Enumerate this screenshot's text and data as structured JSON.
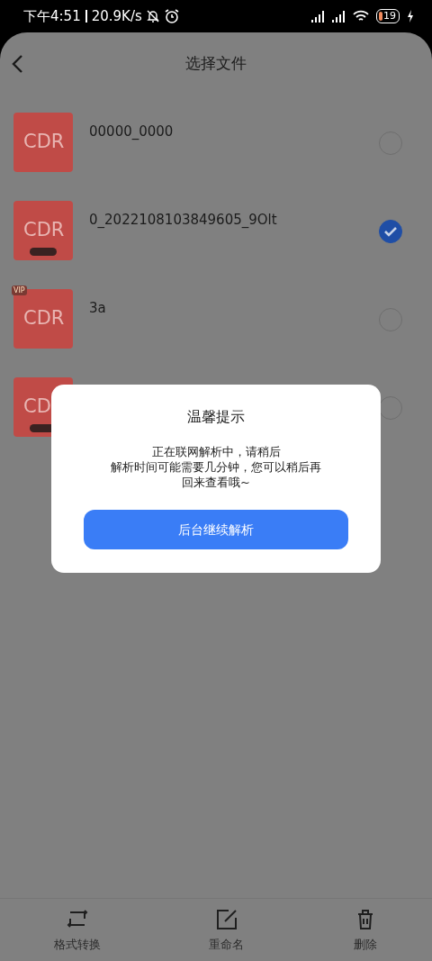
{
  "status_bar": {
    "time": "下午4:51",
    "speed": "20.9K/s",
    "battery": "19"
  },
  "header": {
    "title": "选择文件"
  },
  "files": [
    {
      "label": "CDR",
      "name": "00000_0000",
      "selected": false
    },
    {
      "label": "CDR",
      "name": "0_2022108103849605_9Olt",
      "selected": true,
      "badge": true
    },
    {
      "label": "CDR",
      "name": "3a",
      "selected": false,
      "tag": "VIP"
    },
    {
      "label": "CD",
      "selected": false,
      "badge": true
    }
  ],
  "dialog": {
    "title": "温馨提示",
    "message": [
      "正在联网解析中，请稍后",
      "解析时间可能需要几分钟，您可以稍后再",
      "回来查看哦~"
    ],
    "button": "后台继续解析"
  },
  "toolbar": [
    {
      "kind": "convert",
      "label": "格式转换"
    },
    {
      "kind": "rename",
      "label": "重命名"
    },
    {
      "kind": "delete",
      "label": "删除"
    }
  ]
}
